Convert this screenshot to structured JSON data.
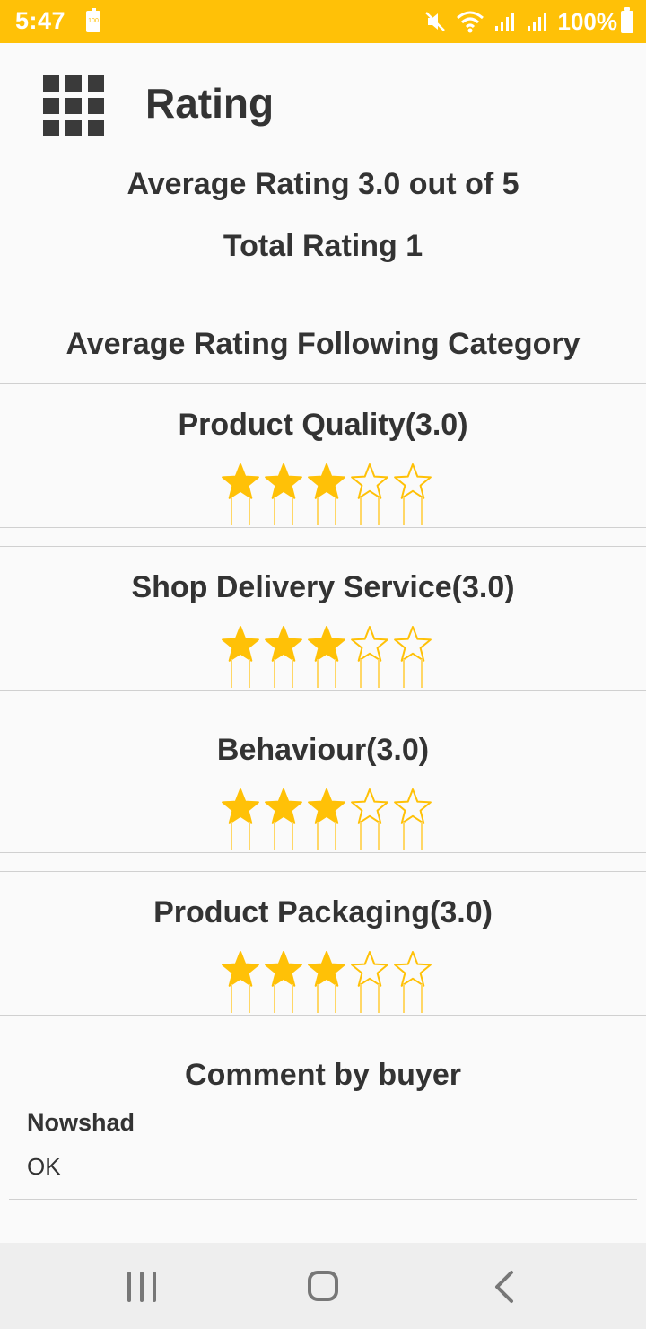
{
  "status_bar": {
    "time": "5:47",
    "battery_small_label": "100",
    "battery_percent": "100%",
    "icons": [
      "battery-saver-icon",
      "mute-icon",
      "wifi-icon",
      "signal-icon",
      "signal-icon",
      "battery-icon"
    ]
  },
  "header": {
    "title": "Rating",
    "menu_icon": "apps-grid-icon"
  },
  "summary": {
    "average": "Average Rating 3.0 out of 5",
    "total": "Total Rating 1",
    "category_heading": "Average Rating Following Category"
  },
  "categories": [
    {
      "label": "Product Quality(3.0)",
      "rating": 3,
      "max": 5
    },
    {
      "label": "Shop Delivery Service(3.0)",
      "rating": 3,
      "max": 5
    },
    {
      "label": "Behaviour(3.0)",
      "rating": 3,
      "max": 5
    },
    {
      "label": "Product Packaging(3.0)",
      "rating": 3,
      "max": 5
    }
  ],
  "comments": {
    "heading": "Comment by buyer",
    "items": [
      {
        "name": "Nowshad",
        "text": "OK"
      }
    ]
  },
  "colors": {
    "accent": "#ffc107",
    "star_filled": "#ffc107",
    "star_empty_stroke": "#ffc107",
    "text": "#333333"
  },
  "nav_bar": {
    "icons": [
      "recents-icon",
      "home-icon",
      "back-icon"
    ]
  }
}
